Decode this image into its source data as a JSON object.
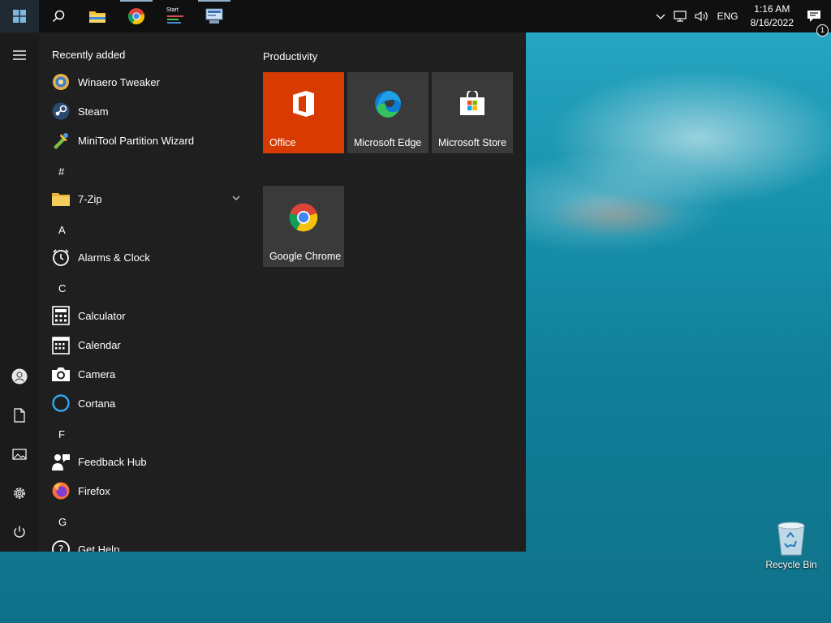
{
  "taskbar": {
    "apps": [
      {
        "name": "search-icon"
      },
      {
        "name": "file-explorer-icon"
      },
      {
        "name": "chrome-icon"
      },
      {
        "name": "startisback-icon",
        "label": "Start"
      },
      {
        "name": "network-app-icon"
      }
    ],
    "tray": {
      "language": "ENG",
      "time": "1:16 AM",
      "date": "8/16/2022",
      "notifications_count": "1"
    }
  },
  "start_menu": {
    "recently_added_header": "Recently added",
    "recent_apps": [
      "Winaero Tweaker",
      "Steam",
      "MiniTool Partition Wizard"
    ],
    "groups": [
      {
        "letter": "#",
        "apps": [
          "7-Zip"
        ]
      },
      {
        "letter": "A",
        "apps": [
          "Alarms & Clock"
        ]
      },
      {
        "letter": "C",
        "apps": [
          "Calculator",
          "Calendar",
          "Camera",
          "Cortana"
        ]
      },
      {
        "letter": "F",
        "apps": [
          "Feedback Hub",
          "Firefox"
        ]
      },
      {
        "letter": "G",
        "apps": [
          "Get Help"
        ]
      }
    ],
    "tiles_group": "Productivity",
    "tiles": [
      {
        "label": "Office",
        "color": "#d83b01"
      },
      {
        "label": "Microsoft Edge",
        "color": "#3a3a3a"
      },
      {
        "label": "Microsoft Store",
        "color": "#3a3a3a"
      },
      {
        "label": "Google Chrome",
        "color": "#3a3a3a"
      }
    ]
  },
  "desktop": {
    "recycle_bin_label": "Recycle Bin"
  }
}
